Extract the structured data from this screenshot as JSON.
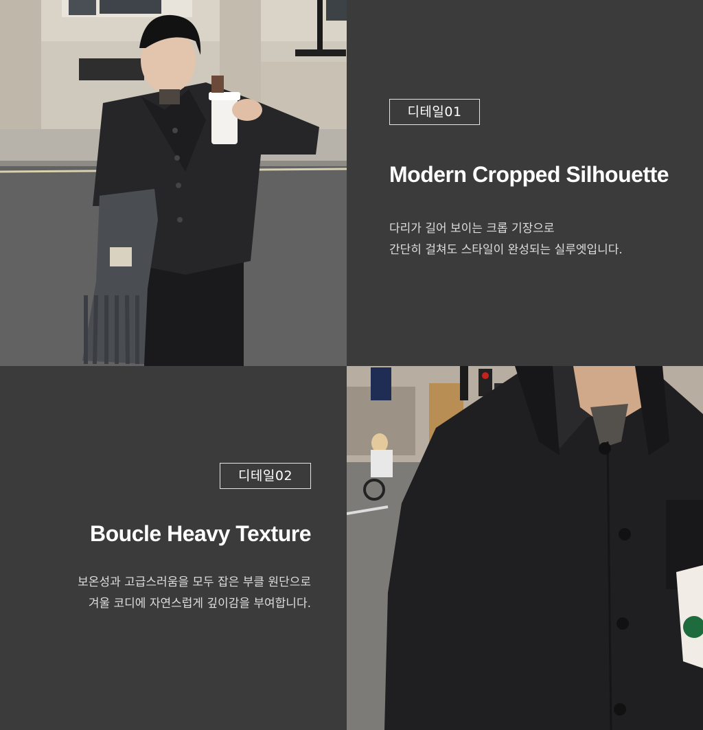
{
  "details": [
    {
      "badge": "디테일01",
      "title": "Modern Cropped Silhouette",
      "lines": [
        "다리가 길어 보이는 크롭 기장으로",
        "간단히 걸쳐도 스타일이 완성되는 실루엣입니다."
      ]
    },
    {
      "badge": "디테일02",
      "title": "Boucle Heavy Texture",
      "lines": [
        "보온성과 고급스러움을 모두 잡은 부클 원단으로",
        "겨울 코디에 자연스럽게 깊이감을 부여합니다."
      ]
    }
  ],
  "colors": {
    "panel_bg": "#3b3b3b",
    "text": "#ffffff",
    "border": "#e6e6e6"
  },
  "photos": {
    "top_left": "model-full-body-street-photo",
    "bottom_right": "jacket-closeup-photo"
  }
}
